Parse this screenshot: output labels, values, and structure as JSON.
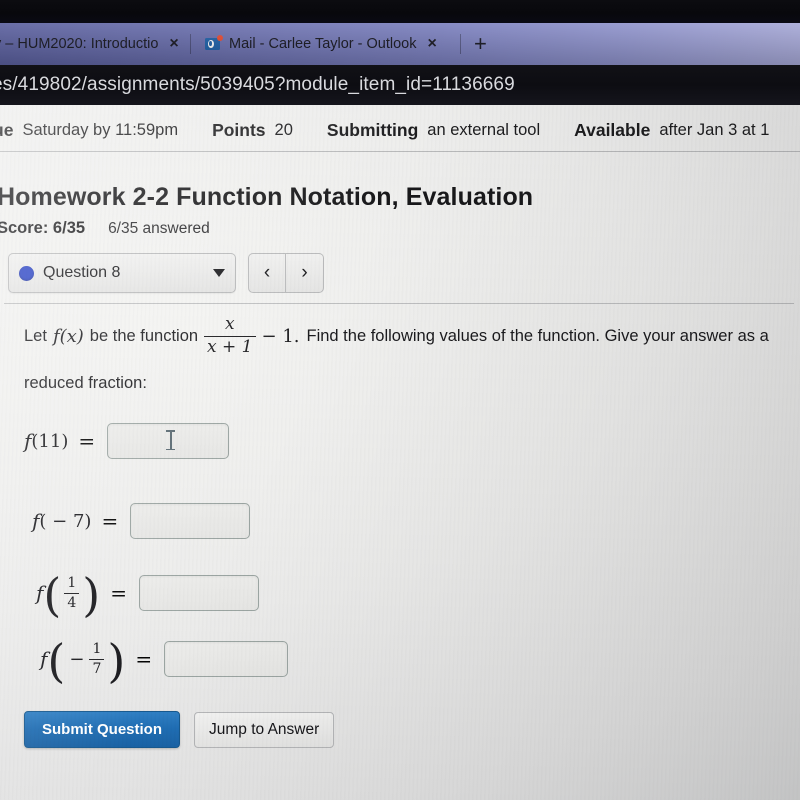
{
  "browser": {
    "tabs": [
      {
        "title": "y – HUM2020: Introductio",
        "close_label": "×",
        "favicon": "none"
      },
      {
        "title": "Mail - Carlee Taylor - Outlook",
        "close_label": "×",
        "favicon": "outlook-icon"
      }
    ],
    "new_tab_label": "+",
    "url": "es/419802/assignments/5039405?module_item_id=11136669"
  },
  "assignment_meta": {
    "due_key": "ue",
    "due_value": "Saturday by 11:59pm",
    "points_key": "Points",
    "points_value": "20",
    "submitting_key": "Submitting",
    "submitting_value": "an external tool",
    "available_key": "Available",
    "available_value": "after Jan 3 at 1"
  },
  "assignment": {
    "title": "Homework 2-2 Function Notation, Evaluation",
    "score_label": "Score: 6/35",
    "answered_label": "6/35 answered"
  },
  "question_nav": {
    "current_question": "Question 8",
    "caret": "▼",
    "prev_label": "‹",
    "next_label": "›",
    "status_color": "#2741c4"
  },
  "question": {
    "prompt_part1": "Let",
    "fn_notation": "f(x)",
    "prompt_part2": "be the function",
    "fraction_numerator": "x",
    "fraction_denominator": "x + 1",
    "minus_one": "− 1.",
    "prompt_part3": "Find the following values of the function. Give your answer as a",
    "prompt_line2": "reduced fraction:",
    "answers": [
      {
        "label_fn": "f",
        "label_arg": "(11)",
        "equals": "=",
        "value": "",
        "placeholder": ""
      },
      {
        "label_fn": "f",
        "label_arg": "( − 7)",
        "equals": "=",
        "value": "",
        "placeholder": ""
      },
      {
        "label_fn": "f",
        "arg_num": "1",
        "arg_den": "4",
        "equals": "=",
        "value": "",
        "placeholder": ""
      },
      {
        "label_fn": "f",
        "arg_sign": "−",
        "arg_num": "1",
        "arg_den": "7",
        "equals": "=",
        "value": "",
        "placeholder": ""
      }
    ]
  },
  "actions": {
    "submit_label": "Submit Question",
    "jump_label": "Jump to Answer",
    "submit_color": "#1f6db3"
  }
}
